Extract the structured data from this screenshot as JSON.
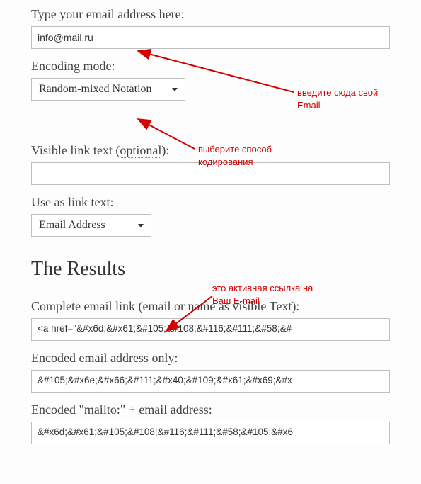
{
  "labels": {
    "email": "Type your email address here:",
    "encoding": "Encoding mode:",
    "visible_pre": "Visible link text (",
    "visible_opt": "optional",
    "visible_post": "):",
    "use_as": "Use as link text:"
  },
  "inputs": {
    "email_value": "info@mail.ru",
    "visible_value": ""
  },
  "selects": {
    "encoding_value": "Random-mixed Notation",
    "useas_value": "Email Address"
  },
  "results": {
    "heading": "The Results",
    "complete_label": "Complete email link (email or name as visible Text):",
    "complete_value": "<a href=\"&#x6d;&#x61;&#105;&#108;&#116;&#111;&#58;&#",
    "encoded_only_label": "Encoded email address only:",
    "encoded_only_value": "&#105;&#x6e;&#x66;&#111;&#x40;&#109;&#x61;&#x69;&#x",
    "mailto_label": "Encoded \"mailto:\" + email address:",
    "mailto_value": "&#x6d;&#x61;&#105;&#108;&#116;&#111;&#58;&#105;&#x6"
  },
  "annotations": {
    "a1_l1": "введите сюда свой",
    "a1_l2": "Email",
    "a2_l1": "выберите способ",
    "a2_l2": "кодирования",
    "a3_l1": "это активная ссылка на",
    "a3_l2": "Ваш E-mail"
  }
}
